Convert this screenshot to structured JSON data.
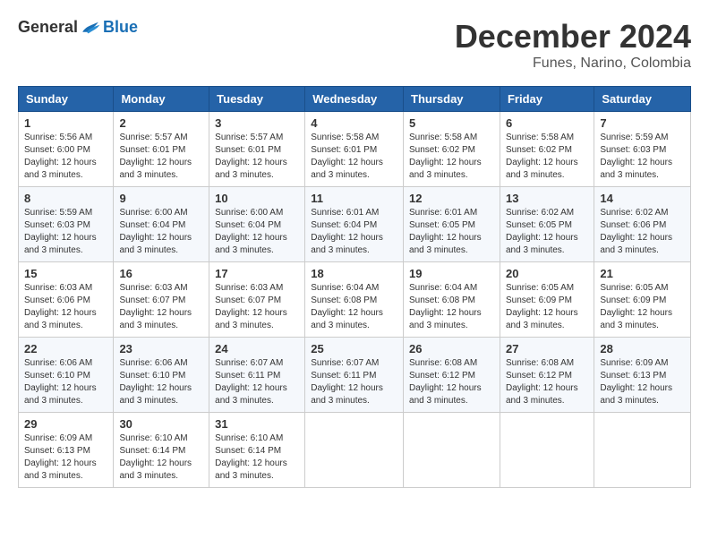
{
  "logo": {
    "general": "General",
    "blue": "Blue"
  },
  "title": "December 2024",
  "location": "Funes, Narino, Colombia",
  "days_of_week": [
    "Sunday",
    "Monday",
    "Tuesday",
    "Wednesday",
    "Thursday",
    "Friday",
    "Saturday"
  ],
  "weeks": [
    [
      {
        "day": "1",
        "sunrise": "5:56 AM",
        "sunset": "6:00 PM",
        "daylight": "12 hours and 3 minutes."
      },
      {
        "day": "2",
        "sunrise": "5:57 AM",
        "sunset": "6:01 PM",
        "daylight": "12 hours and 3 minutes."
      },
      {
        "day": "3",
        "sunrise": "5:57 AM",
        "sunset": "6:01 PM",
        "daylight": "12 hours and 3 minutes."
      },
      {
        "day": "4",
        "sunrise": "5:58 AM",
        "sunset": "6:01 PM",
        "daylight": "12 hours and 3 minutes."
      },
      {
        "day": "5",
        "sunrise": "5:58 AM",
        "sunset": "6:02 PM",
        "daylight": "12 hours and 3 minutes."
      },
      {
        "day": "6",
        "sunrise": "5:58 AM",
        "sunset": "6:02 PM",
        "daylight": "12 hours and 3 minutes."
      },
      {
        "day": "7",
        "sunrise": "5:59 AM",
        "sunset": "6:03 PM",
        "daylight": "12 hours and 3 minutes."
      }
    ],
    [
      {
        "day": "8",
        "sunrise": "5:59 AM",
        "sunset": "6:03 PM",
        "daylight": "12 hours and 3 minutes."
      },
      {
        "day": "9",
        "sunrise": "6:00 AM",
        "sunset": "6:04 PM",
        "daylight": "12 hours and 3 minutes."
      },
      {
        "day": "10",
        "sunrise": "6:00 AM",
        "sunset": "6:04 PM",
        "daylight": "12 hours and 3 minutes."
      },
      {
        "day": "11",
        "sunrise": "6:01 AM",
        "sunset": "6:04 PM",
        "daylight": "12 hours and 3 minutes."
      },
      {
        "day": "12",
        "sunrise": "6:01 AM",
        "sunset": "6:05 PM",
        "daylight": "12 hours and 3 minutes."
      },
      {
        "day": "13",
        "sunrise": "6:02 AM",
        "sunset": "6:05 PM",
        "daylight": "12 hours and 3 minutes."
      },
      {
        "day": "14",
        "sunrise": "6:02 AM",
        "sunset": "6:06 PM",
        "daylight": "12 hours and 3 minutes."
      }
    ],
    [
      {
        "day": "15",
        "sunrise": "6:03 AM",
        "sunset": "6:06 PM",
        "daylight": "12 hours and 3 minutes."
      },
      {
        "day": "16",
        "sunrise": "6:03 AM",
        "sunset": "6:07 PM",
        "daylight": "12 hours and 3 minutes."
      },
      {
        "day": "17",
        "sunrise": "6:03 AM",
        "sunset": "6:07 PM",
        "daylight": "12 hours and 3 minutes."
      },
      {
        "day": "18",
        "sunrise": "6:04 AM",
        "sunset": "6:08 PM",
        "daylight": "12 hours and 3 minutes."
      },
      {
        "day": "19",
        "sunrise": "6:04 AM",
        "sunset": "6:08 PM",
        "daylight": "12 hours and 3 minutes."
      },
      {
        "day": "20",
        "sunrise": "6:05 AM",
        "sunset": "6:09 PM",
        "daylight": "12 hours and 3 minutes."
      },
      {
        "day": "21",
        "sunrise": "6:05 AM",
        "sunset": "6:09 PM",
        "daylight": "12 hours and 3 minutes."
      }
    ],
    [
      {
        "day": "22",
        "sunrise": "6:06 AM",
        "sunset": "6:10 PM",
        "daylight": "12 hours and 3 minutes."
      },
      {
        "day": "23",
        "sunrise": "6:06 AM",
        "sunset": "6:10 PM",
        "daylight": "12 hours and 3 minutes."
      },
      {
        "day": "24",
        "sunrise": "6:07 AM",
        "sunset": "6:11 PM",
        "daylight": "12 hours and 3 minutes."
      },
      {
        "day": "25",
        "sunrise": "6:07 AM",
        "sunset": "6:11 PM",
        "daylight": "12 hours and 3 minutes."
      },
      {
        "day": "26",
        "sunrise": "6:08 AM",
        "sunset": "6:12 PM",
        "daylight": "12 hours and 3 minutes."
      },
      {
        "day": "27",
        "sunrise": "6:08 AM",
        "sunset": "6:12 PM",
        "daylight": "12 hours and 3 minutes."
      },
      {
        "day": "28",
        "sunrise": "6:09 AM",
        "sunset": "6:13 PM",
        "daylight": "12 hours and 3 minutes."
      }
    ],
    [
      {
        "day": "29",
        "sunrise": "6:09 AM",
        "sunset": "6:13 PM",
        "daylight": "12 hours and 3 minutes."
      },
      {
        "day": "30",
        "sunrise": "6:10 AM",
        "sunset": "6:14 PM",
        "daylight": "12 hours and 3 minutes."
      },
      {
        "day": "31",
        "sunrise": "6:10 AM",
        "sunset": "6:14 PM",
        "daylight": "12 hours and 3 minutes."
      },
      null,
      null,
      null,
      null
    ]
  ],
  "labels": {
    "sunrise": "Sunrise:",
    "sunset": "Sunset:",
    "daylight": "Daylight:"
  }
}
